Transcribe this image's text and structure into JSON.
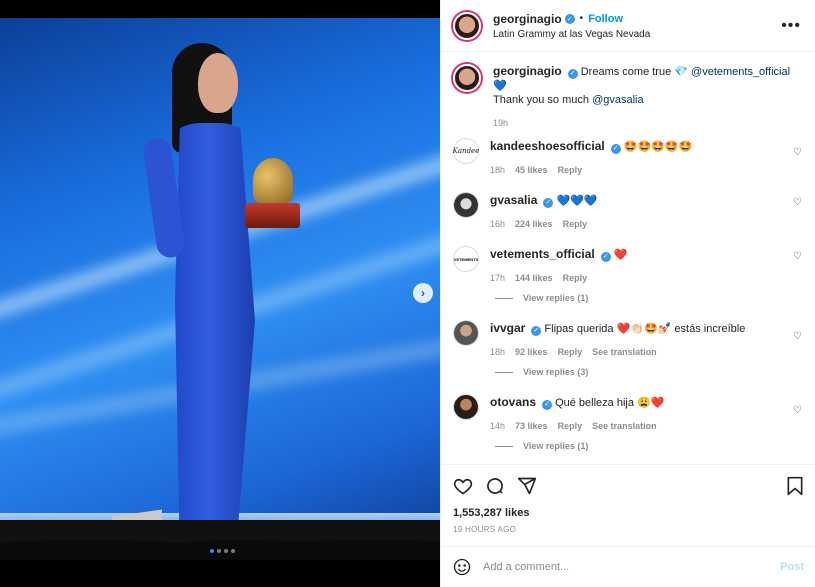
{
  "post": {
    "author": "georginagio",
    "follow_label": "Follow",
    "location": "Latin Grammy at las Vegas Nevada",
    "more_icon": "more-horizontal-icon",
    "carousel_dots": 4
  },
  "caption": {
    "username": "georginagio",
    "text_start": "Dreams come true 💎",
    "mention1": "@vetements_official",
    "text_mid": " 💙",
    "text_line2": "Thank you so much ",
    "mention2": "@gvasalia",
    "time": "19h"
  },
  "comments": [
    {
      "username": "kandeeshoesofficial",
      "text": "🤩🤩🤩🤩🤩",
      "time": "18h",
      "likes": "45 likes",
      "reply": "Reply",
      "avatar_text": "Kandee"
    },
    {
      "username": "gvasalia",
      "text": "💙💙💙",
      "time": "16h",
      "likes": "224 likes",
      "reply": "Reply"
    },
    {
      "username": "vetements_official",
      "text": "❤️",
      "time": "17h",
      "likes": "144 likes",
      "reply": "Reply",
      "avatar_text": "VETEMENTS",
      "view_replies": "View replies (1)"
    },
    {
      "username": "ivvgar",
      "text": "Flipas querida ❤️👏🏻🤩💅🏻 estás increíble",
      "time": "18h",
      "likes": "92 likes",
      "reply": "Reply",
      "translate": "See translation",
      "view_replies": "View replies (3)"
    },
    {
      "username": "otovans",
      "text": "Qué belleza hija 😩❤️",
      "time": "14h",
      "likes": "73 likes",
      "reply": "Reply",
      "translate": "See translation",
      "view_replies": "View replies (1)"
    }
  ],
  "actions": {
    "likes": "1,553,287 likes",
    "time_ago": "19 HOURS AGO"
  },
  "comment_box": {
    "placeholder": "Add a comment...",
    "post_label": "Post"
  },
  "colors": {
    "accent": "#0095f6",
    "verified": "#3897f0",
    "post_disabled": "#b2dffc",
    "heart_red": "#ed4956"
  }
}
